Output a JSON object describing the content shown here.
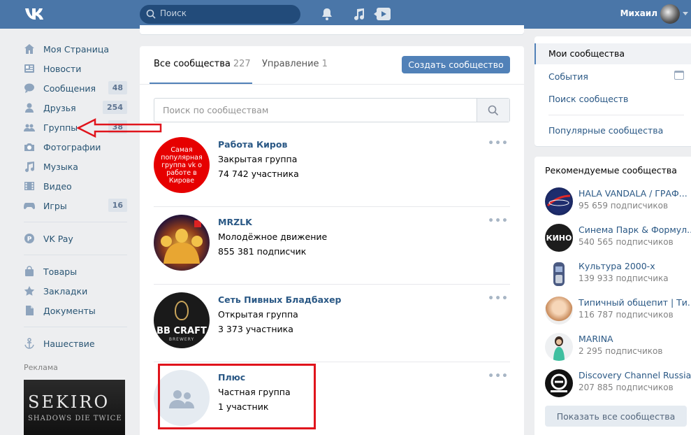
{
  "header": {
    "search_placeholder": "Поиск",
    "user_name": "Михаил"
  },
  "nav": {
    "items": [
      {
        "label": "Моя Страница",
        "icon": "home-icon"
      },
      {
        "label": "Новости",
        "icon": "news-icon"
      },
      {
        "label": "Сообщения",
        "icon": "messages-icon",
        "badge": "48"
      },
      {
        "label": "Друзья",
        "icon": "friends-icon",
        "badge": "254"
      },
      {
        "label": "Группы",
        "icon": "groups-icon",
        "badge": "38"
      },
      {
        "label": "Фотографии",
        "icon": "camera-icon"
      },
      {
        "label": "Музыка",
        "icon": "music-icon"
      },
      {
        "label": "Видео",
        "icon": "video-icon"
      },
      {
        "label": "Игры",
        "icon": "gamepad-icon",
        "badge": "16"
      },
      {
        "label": "VK Pay",
        "icon": "vkpay-icon"
      },
      {
        "label": "Товары",
        "icon": "bag-icon"
      },
      {
        "label": "Закладки",
        "icon": "star-icon"
      },
      {
        "label": "Документы",
        "icon": "document-icon"
      },
      {
        "label": "Нашествие",
        "icon": "anchor-icon"
      }
    ],
    "ads_label": "Реклама",
    "ad": {
      "title": "SEKIRO",
      "subtitle": "SHADOWS DIE TWICE"
    }
  },
  "main": {
    "tabs": [
      {
        "label": "Все сообщества",
        "count": "227"
      },
      {
        "label": "Управление",
        "count": "1"
      }
    ],
    "create_label": "Создать сообщество",
    "search_placeholder": "Поиск по сообществам",
    "groups": [
      {
        "name": "Работа Киров",
        "type": "Закрытая группа",
        "count": "74 742 участника",
        "avatar_text": "Самая популярная группа vk о работе в Кирове"
      },
      {
        "name": "MRZLK",
        "type": "Молодёжное движение",
        "count": "855 381 подписчик"
      },
      {
        "name": "Сеть Пивных Бладбахер",
        "type": "Открытая группа",
        "count": "3 373 участника",
        "avatar_text": "BB CRAFT",
        "avatar_sub": "BREWERY"
      },
      {
        "name": "Плюс",
        "type": "Частная группа",
        "count": "1 участник"
      }
    ],
    "more_label": "•••"
  },
  "right": {
    "menu": [
      "Мои сообщества",
      "События",
      "Поиск сообществ",
      "Популярные сообщества"
    ],
    "rec_title": "Рекомендуемые сообщества",
    "recs": [
      {
        "name": "HALA VANDALA / ГРАФ...",
        "count": "95 659 подписчиков"
      },
      {
        "name": "Синема Парк & Формул...",
        "count": "540 565 подписчиков",
        "avatar_text": "КИНО"
      },
      {
        "name": "Культура 2000-х",
        "count": "139 933 подписчика"
      },
      {
        "name": "Типичный общепит | Ти...",
        "count": "116 787 подписчиков"
      },
      {
        "name": "MARINA",
        "count": "2 295 подписчиков"
      },
      {
        "name": "Discovery Channel Russia",
        "count": "207 885 подписчиков"
      }
    ],
    "show_all": "Показать все сообщества"
  },
  "colors": {
    "brand": "#4a76a8",
    "link": "#2a5885",
    "button": "#5181b8",
    "annotation": "#e0141c"
  }
}
